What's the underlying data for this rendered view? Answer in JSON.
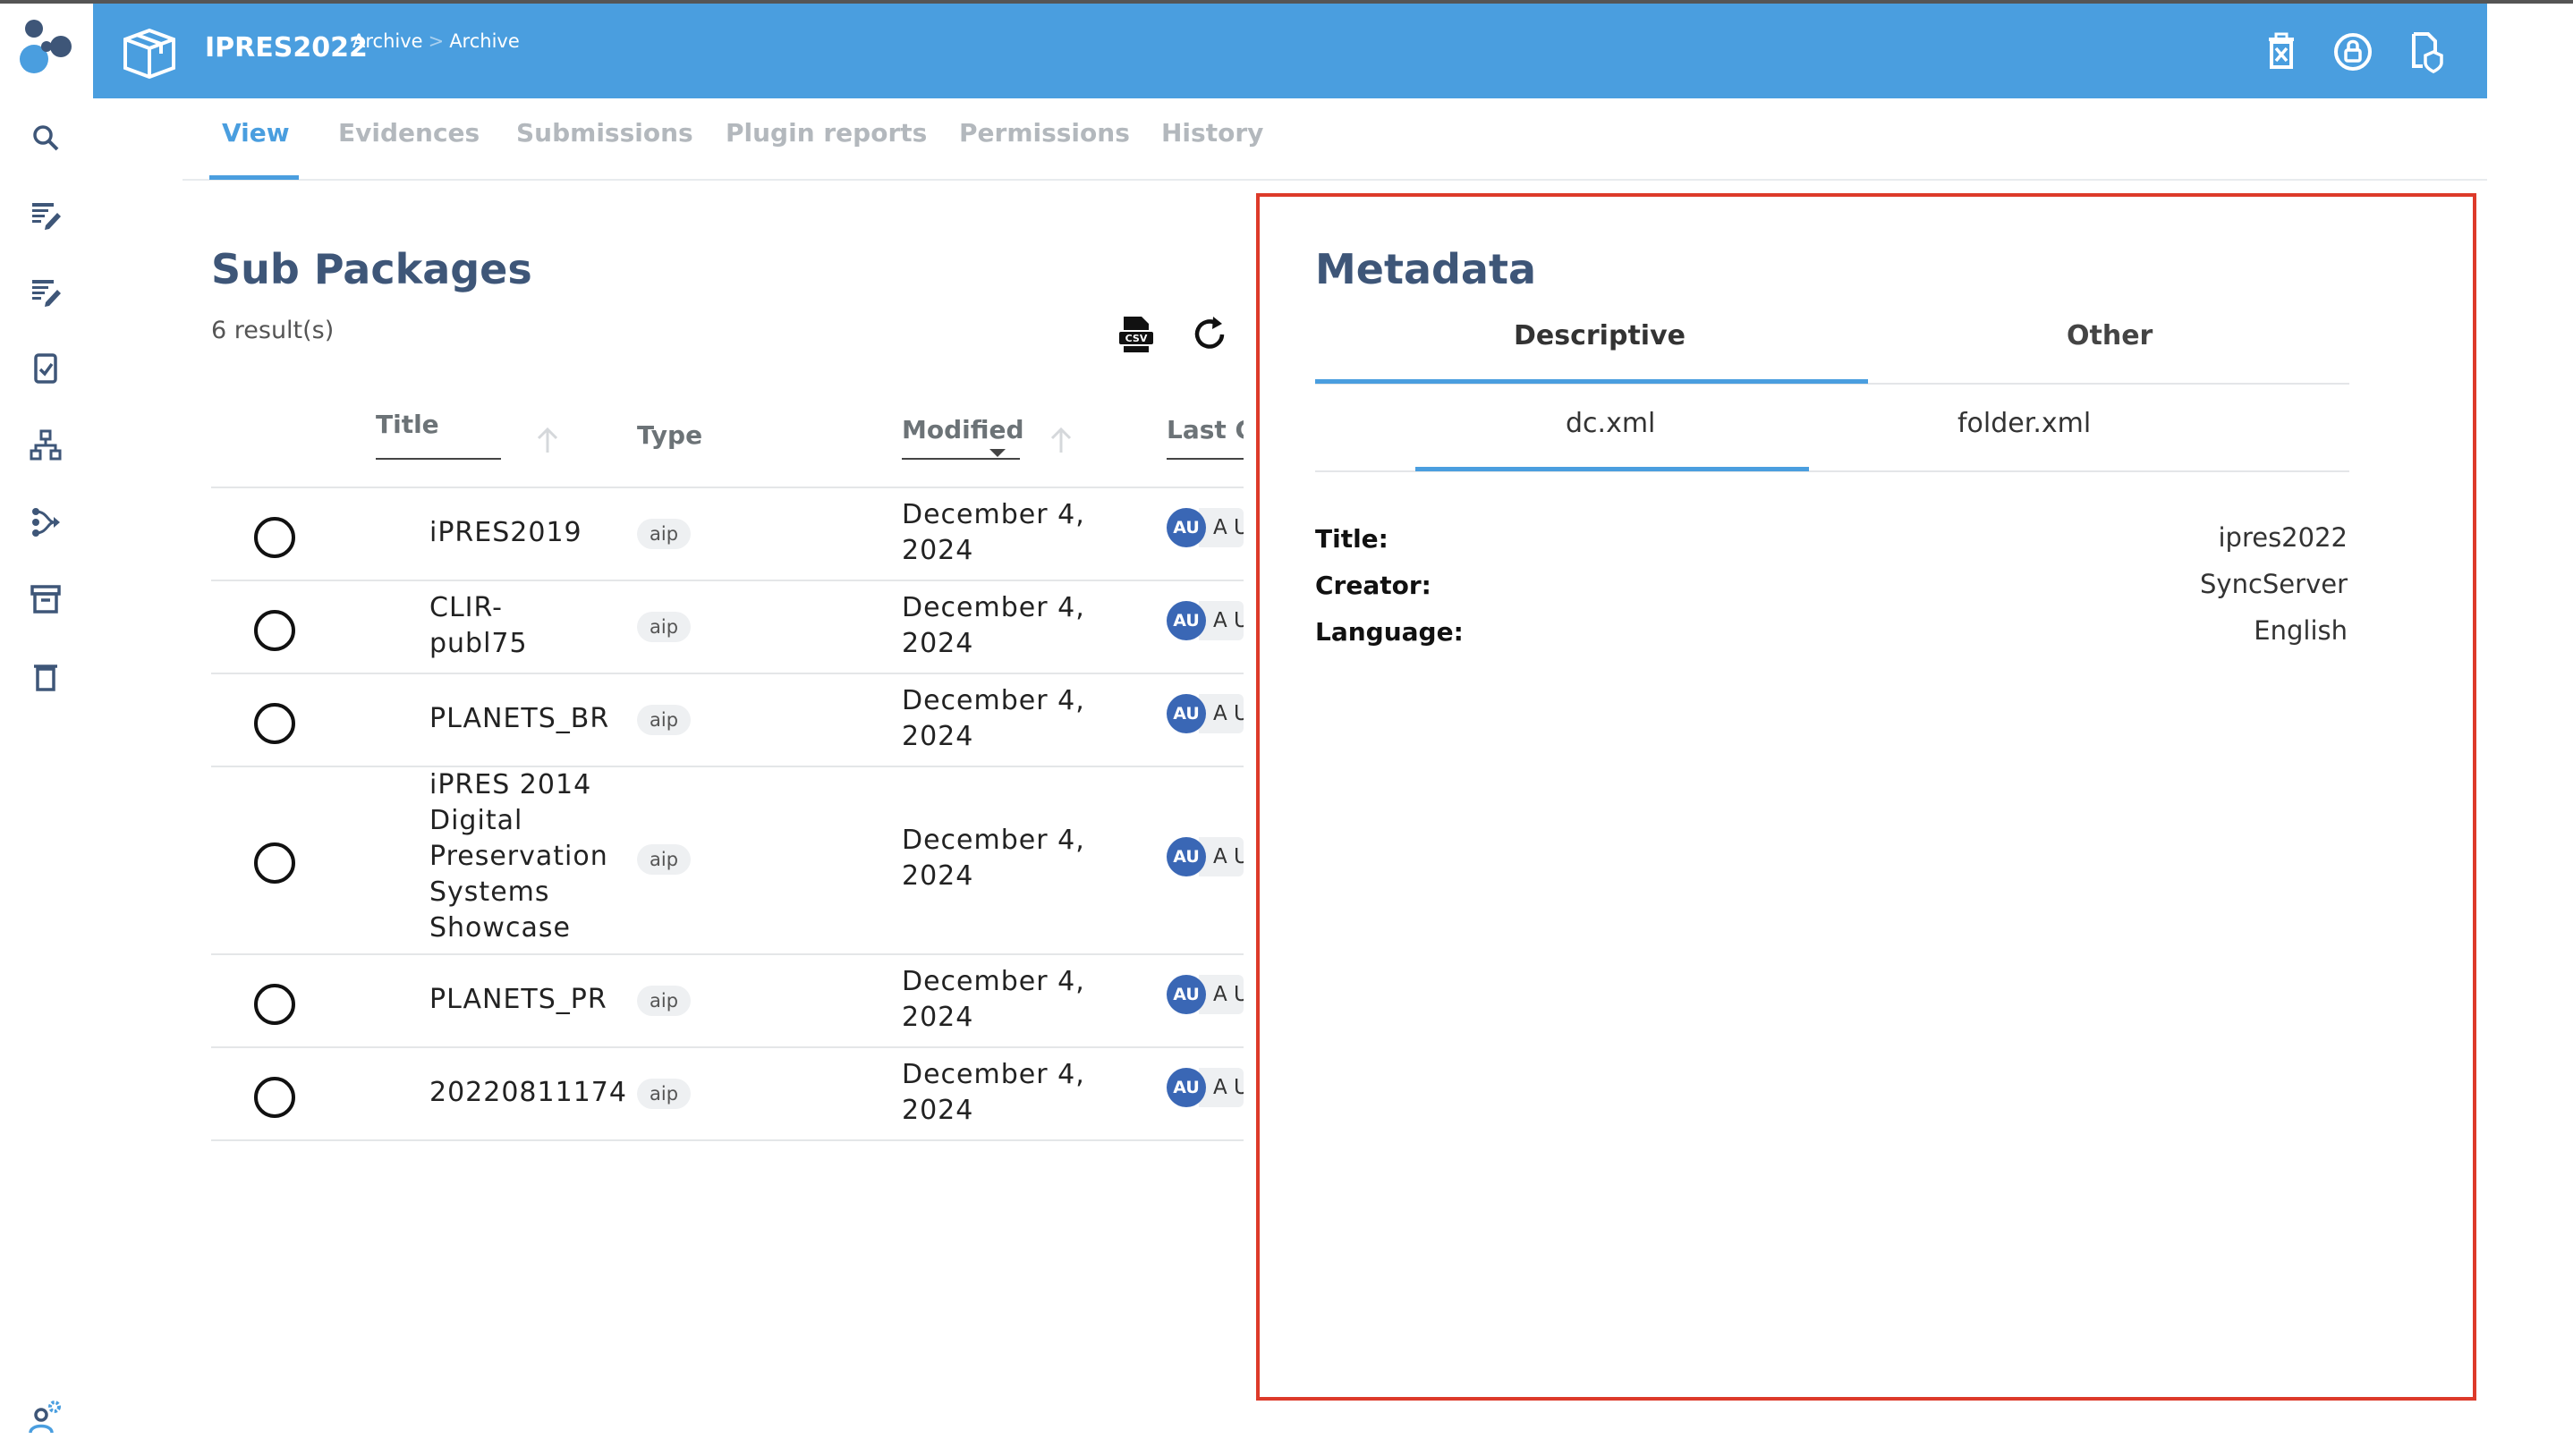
{
  "header": {
    "title": "IPRES2022",
    "breadcrumb": [
      "Archive",
      "Archive"
    ],
    "breadcrumb_sep": ">"
  },
  "tabs": [
    {
      "label": "View",
      "active": true
    },
    {
      "label": "Evidences"
    },
    {
      "label": "Submissions"
    },
    {
      "label": "Plugin reports"
    },
    {
      "label": "Permissions"
    },
    {
      "label": "History"
    }
  ],
  "sub_packages": {
    "title": "Sub Packages",
    "count": "6 result(s)",
    "columns": [
      "Title",
      "Type",
      "Modified",
      "Last C"
    ],
    "rows": [
      {
        "title": "iPRES2019",
        "type": "aip",
        "modified": "December 4, 2024",
        "avatar": "AU",
        "user": "A U"
      },
      {
        "title": "CLIR-publ75",
        "type": "aip",
        "modified": "December 4, 2024",
        "avatar": "AU",
        "user": "A U"
      },
      {
        "title": "PLANETS_BR",
        "type": "aip",
        "modified": "December 4, 2024",
        "avatar": "AU",
        "user": "A U"
      },
      {
        "title": "iPRES 2014 Digital Preservation Systems Showcase",
        "type": "aip",
        "modified": "December 4, 2024",
        "avatar": "AU",
        "user": "A U"
      },
      {
        "title": "PLANETS_PR",
        "type": "aip",
        "modified": "December 4, 2024",
        "avatar": "AU",
        "user": "A U"
      },
      {
        "title": "20220811174",
        "type": "aip",
        "modified": "December 4, 2024",
        "avatar": "AU",
        "user": "A U"
      }
    ]
  },
  "metadata": {
    "title": "Metadata",
    "tabs": [
      "Descriptive",
      "Other"
    ],
    "files": [
      "dc.xml",
      "folder.xml"
    ],
    "fields": [
      {
        "label": "Title:",
        "value": "ipres2022"
      },
      {
        "label": "Creator:",
        "value": "SyncServer"
      },
      {
        "label": "Language:",
        "value": "English"
      }
    ]
  },
  "colors": {
    "accent": "#4a9edf",
    "highlight_border": "#dd3a2a",
    "avatar": "#3a67b5"
  }
}
